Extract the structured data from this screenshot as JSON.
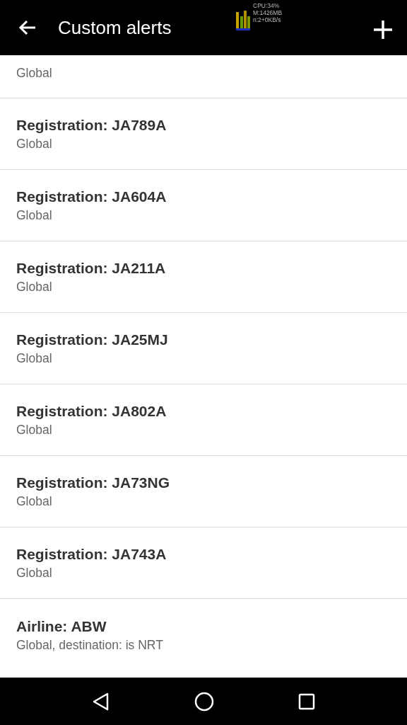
{
  "toolbar": {
    "title": "Custom alerts"
  },
  "monitor_overlay": {
    "cpu": "CPU:34%",
    "memory": "M:1426MB",
    "network": "n:2+0KB/s"
  },
  "alerts": [
    {
      "subtitle": "Global"
    },
    {
      "title": "Registration: JA789A",
      "subtitle": "Global"
    },
    {
      "title": "Registration: JA604A",
      "subtitle": "Global"
    },
    {
      "title": "Registration: JA211A",
      "subtitle": "Global"
    },
    {
      "title": "Registration: JA25MJ",
      "subtitle": "Global"
    },
    {
      "title": "Registration: JA802A",
      "subtitle": "Global"
    },
    {
      "title": "Registration: JA73NG",
      "subtitle": "Global"
    },
    {
      "title": "Registration: JA743A",
      "subtitle": "Global"
    },
    {
      "title": "Airline: ABW",
      "subtitle": "Global, destination: is NRT"
    }
  ]
}
